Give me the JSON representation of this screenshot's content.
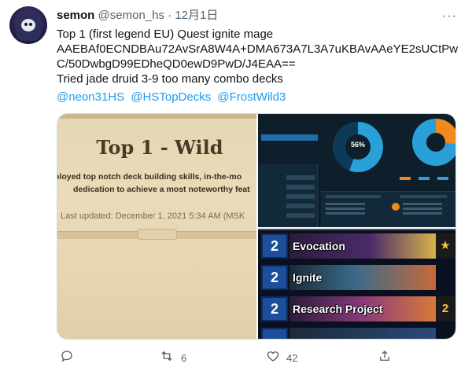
{
  "tweet": {
    "author_name": "semon",
    "author_handle": "@semon_hs",
    "separator": "·",
    "date": "12月1日",
    "more_icon": "···",
    "lines": [
      "Top 1 (first legend EU) Quest ignite mage",
      "AAEBAf0ECNDBAu72AvSrA8W4A+DMA673A7L3A7uKBAvAAeYE2sUCtPw",
      "C/50DwbgD99EDheQD0ewD9PwD/J4EAA==",
      "Tried jade druid 3-9 too many combo decks"
    ],
    "mentions": [
      "@neon31HS",
      "@HSTopDecks",
      "@FrostWild3"
    ]
  },
  "media": {
    "leaderboard": {
      "title": "Top 1 - Wild",
      "line1": "ployed top notch deck building skills, in-the-mo",
      "line2": "dedication to achieve a most noteworthy feat",
      "updated": "Last updated: December 1, 2021 5:34 AM (MSK"
    },
    "stats": {
      "percent": "56%",
      "win_share": 0.56,
      "accent_blue": "#2a9fd8",
      "accent_orange": "#f08a1c"
    },
    "deck": {
      "cards": [
        {
          "cost": "2",
          "name": "Evocation",
          "badge": "★"
        },
        {
          "cost": "2",
          "name": "Ignite",
          "badge": ""
        },
        {
          "cost": "2",
          "name": "Research Project",
          "badge": "2"
        }
      ]
    }
  },
  "actions": {
    "reply_icon": "reply-icon",
    "retweet_icon": "retweet-icon",
    "retweet_count": "6",
    "like_icon": "heart-icon",
    "like_count": "42",
    "share_icon": "share-icon"
  }
}
